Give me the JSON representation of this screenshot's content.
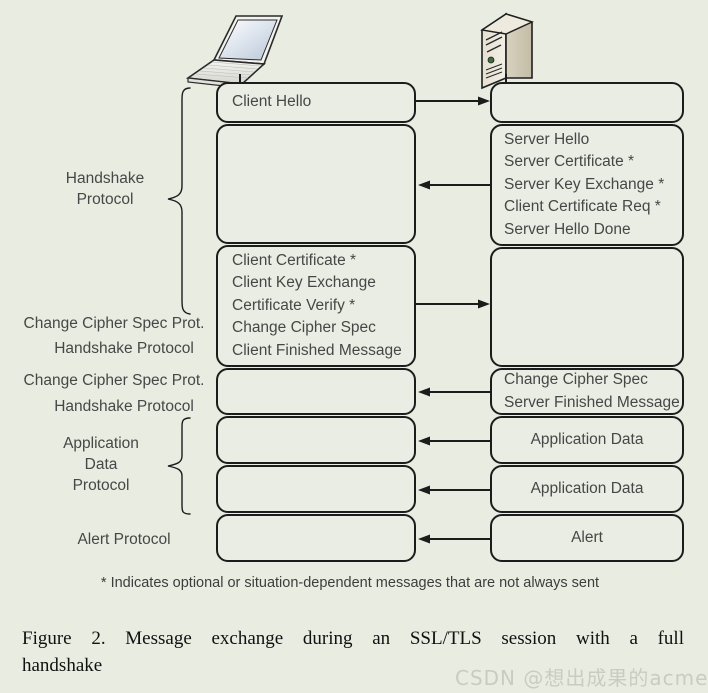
{
  "figure": {
    "background_color": "#e8ece1",
    "box_fill": "#e9ede3",
    "box_stroke": "#1c1c1c",
    "text_color": "#474747"
  },
  "icons": {
    "client": "laptop-icon",
    "server": "server-tower-icon"
  },
  "side_labels": [
    {
      "id": "handshake-protocol",
      "text_lines": [
        "Handshake",
        "Protocol"
      ],
      "braced": true
    },
    {
      "id": "change-cipher-spec-prot-1",
      "text_lines": [
        "Change Cipher Spec Prot."
      ],
      "braced": false
    },
    {
      "id": "handshake-protocol-2",
      "text_lines": [
        "Handshake Protocol"
      ],
      "braced": false
    },
    {
      "id": "change-cipher-spec-prot-2",
      "text_lines": [
        "Change Cipher Spec Prot."
      ],
      "braced": false
    },
    {
      "id": "handshake-protocol-3",
      "text_lines": [
        "Handshake Protocol"
      ],
      "braced": false
    },
    {
      "id": "application-data-protocol",
      "text_lines": [
        "Application",
        "Data",
        "Protocol"
      ],
      "braced": true
    },
    {
      "id": "alert-protocol",
      "text_lines": [
        "Alert Protocol"
      ],
      "braced": false
    }
  ],
  "client_boxes": [
    {
      "id": "client-hello",
      "lines": [
        "Client Hello"
      ],
      "align": "left"
    },
    {
      "id": "client-empty-1",
      "lines": [],
      "align": "left"
    },
    {
      "id": "client-handshake-bundle",
      "lines": [
        "Client Certificate *",
        "Client Key Exchange",
        "Certificate Verify *",
        "Change Cipher Spec",
        "Client Finished Message"
      ],
      "align": "left"
    },
    {
      "id": "client-empty-2",
      "lines": [],
      "align": "left"
    },
    {
      "id": "client-empty-3",
      "lines": [],
      "align": "left"
    },
    {
      "id": "client-empty-4",
      "lines": [],
      "align": "left"
    },
    {
      "id": "client-empty-5",
      "lines": [],
      "align": "left"
    }
  ],
  "server_boxes": [
    {
      "id": "server-empty-1",
      "lines": [],
      "align": "left"
    },
    {
      "id": "server-hello-bundle",
      "lines": [
        "Server Hello",
        "Server Certificate *",
        "Server Key Exchange *",
        "Client Certificate Req *",
        "Server Hello Done"
      ],
      "align": "left"
    },
    {
      "id": "server-empty-2",
      "lines": [],
      "align": "left"
    },
    {
      "id": "server-change-cipher-spec",
      "lines": [
        "Change Cipher Spec",
        "Server Finished Message"
      ],
      "align": "left"
    },
    {
      "id": "server-application-data-1",
      "lines": [
        "Application Data"
      ],
      "align": "center"
    },
    {
      "id": "server-application-data-2",
      "lines": [
        "Application Data"
      ],
      "align": "center"
    },
    {
      "id": "server-alert",
      "lines": [
        "Alert"
      ],
      "align": "center"
    }
  ],
  "arrows": [
    {
      "id": "arrow-client-hello",
      "direction": "right"
    },
    {
      "id": "arrow-server-hello",
      "direction": "left"
    },
    {
      "id": "arrow-client-handshake",
      "direction": "right"
    },
    {
      "id": "arrow-server-change-cipher",
      "direction": "left"
    },
    {
      "id": "arrow-app-data-1",
      "direction": "left"
    },
    {
      "id": "arrow-app-data-2",
      "direction": "left"
    },
    {
      "id": "arrow-alert",
      "direction": "left"
    }
  ],
  "footnote": "* Indicates optional or situation-dependent messages that are not always sent",
  "caption": {
    "line1": "Figure 2.    Message exchange during an SSL/TLS session with a full",
    "line2": "handshake"
  },
  "watermark": "CSDN @想出成果的acmer"
}
